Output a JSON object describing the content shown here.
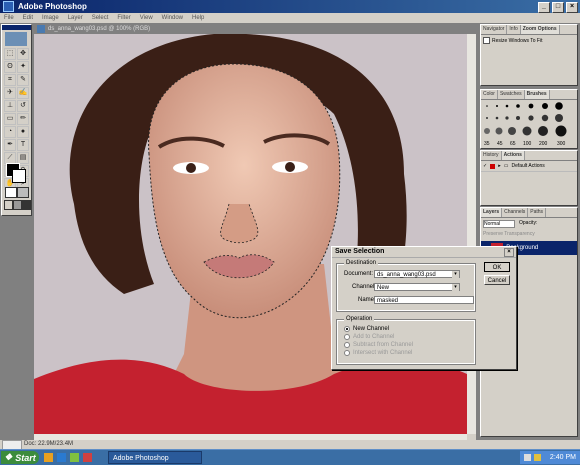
{
  "app": {
    "title": "Adobe Photoshop"
  },
  "menu": [
    "File",
    "Edit",
    "Image",
    "Layer",
    "Select",
    "Filter",
    "View",
    "Window",
    "Help"
  ],
  "document": {
    "title": "ds_anna_wang03.psd @ 100% (RGB)"
  },
  "navigator": {
    "tabs": [
      "Navigator",
      "Info",
      "Zoom Options"
    ],
    "checkbox_label": "Resize Windows To Fit"
  },
  "brushes": {
    "tabs": [
      "Color",
      "Swatches",
      "Brushes"
    ],
    "sizes": [
      "35",
      "45",
      "65",
      "100",
      "200",
      "300"
    ]
  },
  "actions": {
    "tabs": [
      "History",
      "Actions"
    ],
    "item": "Default Actions"
  },
  "layers": {
    "tabs": [
      "Layers",
      "Channels",
      "Paths"
    ],
    "mode": "Normal",
    "opacity_label": "Opacity:",
    "preserve": "Preserve Transparency",
    "layer_name": "Background"
  },
  "dialog": {
    "title": "Save Selection",
    "destination_label": "Destination",
    "document_label": "Document:",
    "document_value": "ds_anna_wang03.psd",
    "channel_label": "Channel:",
    "channel_value": "New",
    "name_label": "Name:",
    "name_value": "masked",
    "operation_label": "Operation",
    "options": [
      "New Channel",
      "Add to Channel",
      "Subtract from Channel",
      "Intersect with Channel"
    ],
    "ok": "OK",
    "cancel": "Cancel"
  },
  "status": {
    "doc": "Doc: 22.9M/23.4M"
  },
  "taskbar": {
    "start": "Start",
    "task": "Adobe Photoshop",
    "clock": "2:40 PM"
  }
}
